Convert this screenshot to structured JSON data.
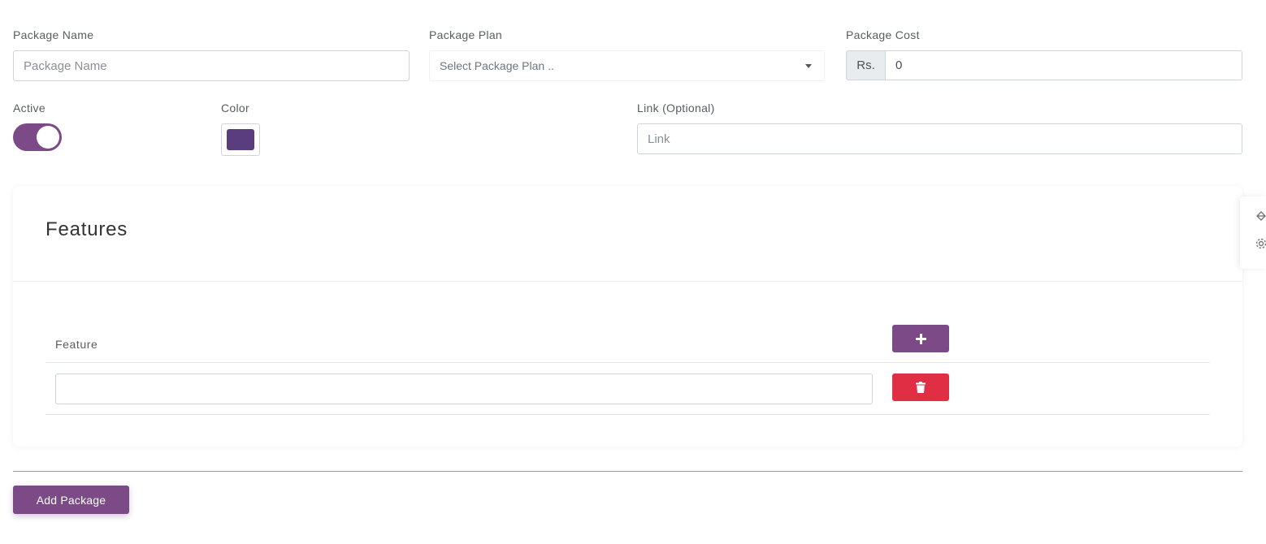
{
  "form": {
    "package_name": {
      "label": "Package Name",
      "placeholder": "Package Name"
    },
    "package_plan": {
      "label": "Package Plan",
      "value": "Select Package Plan .."
    },
    "package_cost": {
      "label": "Package Cost",
      "prefix": "Rs.",
      "value": "0"
    },
    "active": {
      "label": "Active",
      "checked": true
    },
    "color": {
      "label": "Color",
      "value": "#5a3d7e"
    },
    "link": {
      "label": "Link (Optional)",
      "placeholder": "Link"
    }
  },
  "features": {
    "title": "Features",
    "column_header": "Feature",
    "add_button_icon": "plus-icon",
    "delete_button_icon": "trash-icon",
    "rows": [
      {
        "value": ""
      }
    ]
  },
  "actions": {
    "submit_label": "Add Package"
  },
  "side_tab": {
    "icons": [
      "paint-bucket-icon",
      "gear-icon"
    ]
  },
  "colors": {
    "brand": "#7b4a87",
    "danger": "#e02f44",
    "swatch": "#5a3d7e"
  }
}
